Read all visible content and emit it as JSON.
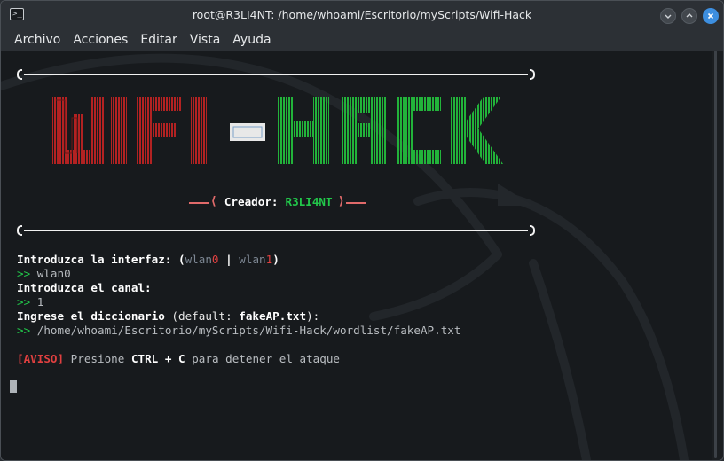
{
  "window": {
    "title": "root@R3LI4NT: /home/whoami/Escritorio/myScripts/Wifi-Hack",
    "icon": "terminal-icon",
    "controls": [
      "minimize-icon",
      "maximize-icon",
      "close-icon"
    ]
  },
  "menu": [
    "Archivo",
    "Acciones",
    "Editar",
    "Vista",
    "Ayuda"
  ],
  "banner": {
    "word_left": "WIFI",
    "word_right": "HACK",
    "left_color": "#b22222",
    "right_color": "#22b33a"
  },
  "creator": {
    "label": "Creador:",
    "name": "R3LI4NT"
  },
  "terminal": {
    "interface_prompt": "Introduzca la interfaz:",
    "interface_opt_a": "wlan",
    "interface_opt_a_num": "0",
    "interface_sep": "|",
    "interface_opt_b": "wlan",
    "interface_opt_b_num": "1",
    "prompt_arrow": ">>",
    "interface_value": "wlan0",
    "channel_prompt": "Introduzca el canal:",
    "channel_value": "1",
    "dict_prompt": "Ingrese el diccionario",
    "dict_default_label": "(default:",
    "dict_default_value": "fakeAP.txt",
    "dict_default_close": "):",
    "dict_value": "/home/whoami/Escritorio/myScripts/Wifi-Hack/wordlist/fakeAP.txt",
    "warn_tag": "[AVISO]",
    "warn_text_a": "Presione",
    "warn_keys": "CTRL + C",
    "warn_text_b": "para detener el ataque"
  },
  "colors": {
    "accent_green": "#22c74a",
    "accent_red": "#e04040",
    "terminal_bg": "#171a1d"
  }
}
